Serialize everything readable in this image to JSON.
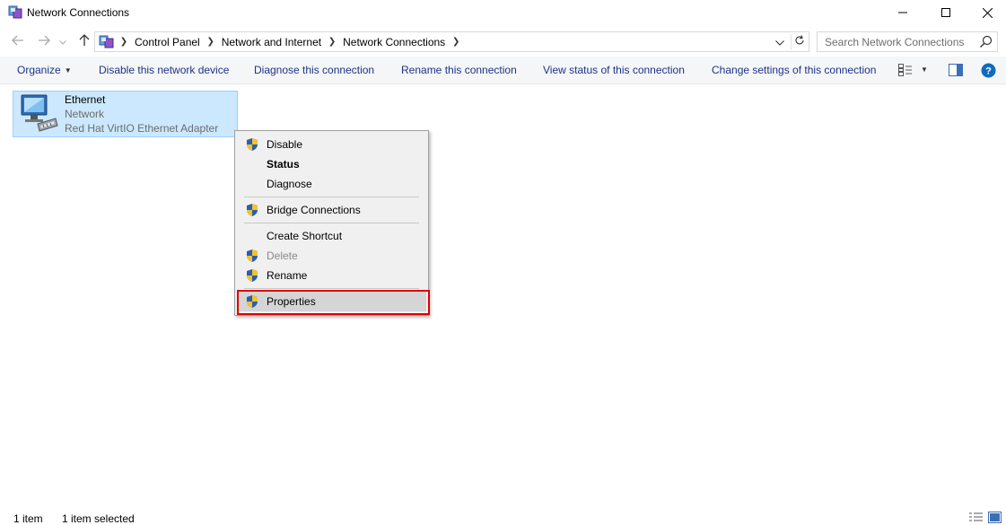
{
  "window": {
    "title": "Network Connections",
    "icon": "network-connections-icon"
  },
  "address": {
    "crumbs": [
      "Control Panel",
      "Network and Internet",
      "Network Connections"
    ],
    "search_placeholder": "Search Network Connections"
  },
  "commands": {
    "organize": "Organize",
    "disable": "Disable this network device",
    "diagnose": "Diagnose this connection",
    "rename": "Rename this connection",
    "view_status": "View status of this connection",
    "change_settings": "Change settings of this connection"
  },
  "item": {
    "name": "Ethernet",
    "network": "Network",
    "adapter": "Red Hat VirtIO Ethernet Adapter"
  },
  "context_menu": {
    "items": [
      {
        "label": "Disable",
        "icon": "uac-shield-icon"
      },
      {
        "label": "Status",
        "icon": ""
      },
      {
        "label": "Diagnose",
        "icon": ""
      },
      {
        "label": "Bridge Connections",
        "icon": "uac-shield-icon"
      },
      {
        "label": "Create Shortcut",
        "icon": ""
      },
      {
        "label": "Delete",
        "icon": "uac-shield-icon"
      },
      {
        "label": "Rename",
        "icon": "uac-shield-icon"
      },
      {
        "label": "Properties",
        "icon": "uac-shield-icon"
      }
    ],
    "highlight_color": "#e00000"
  },
  "status": {
    "count": "1 item",
    "selected": "1 item selected"
  },
  "colors": {
    "command_text": "#1e3287",
    "selection_fill": "#cce8ff",
    "selection_border": "#99d1ff"
  }
}
